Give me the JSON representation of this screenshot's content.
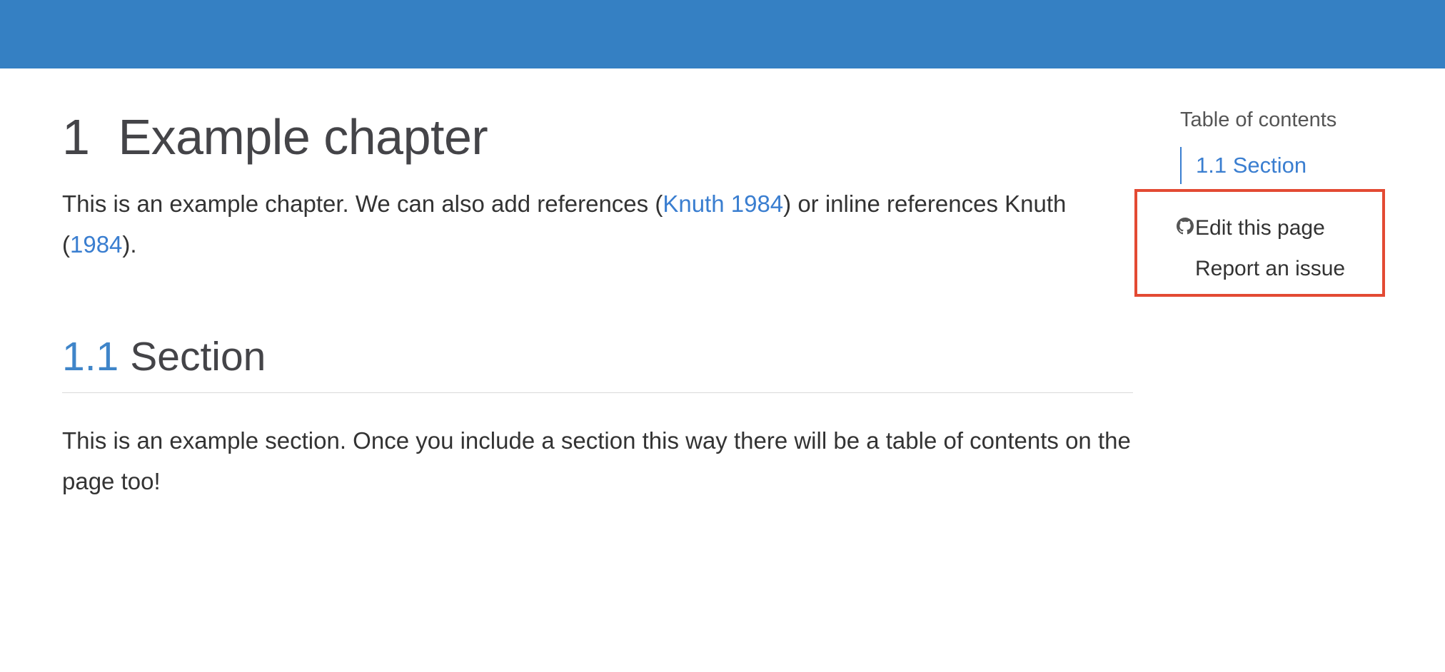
{
  "chapter": {
    "number": "1",
    "title": "Example chapter",
    "intro_before_ref": "This is an example chapter. We can also add references (",
    "ref1": "Knuth 1984",
    "intro_mid": ") or inline references Knuth (",
    "ref2": "1984",
    "intro_end": ")."
  },
  "section": {
    "number": "1.1",
    "title": "Section",
    "body": "This is an example section. Once you include a section this way there will be a table of contents on the page too!"
  },
  "toc": {
    "title": "Table of contents",
    "items": [
      {
        "label": "1.1 Section"
      }
    ]
  },
  "actions": {
    "edit_label": "Edit this page",
    "issue_label": "Report an issue",
    "edit_icon": "github-icon"
  },
  "colors": {
    "topbar": "#3580c3",
    "link": "#3a7ed0",
    "highlight_border": "#e34a33"
  }
}
